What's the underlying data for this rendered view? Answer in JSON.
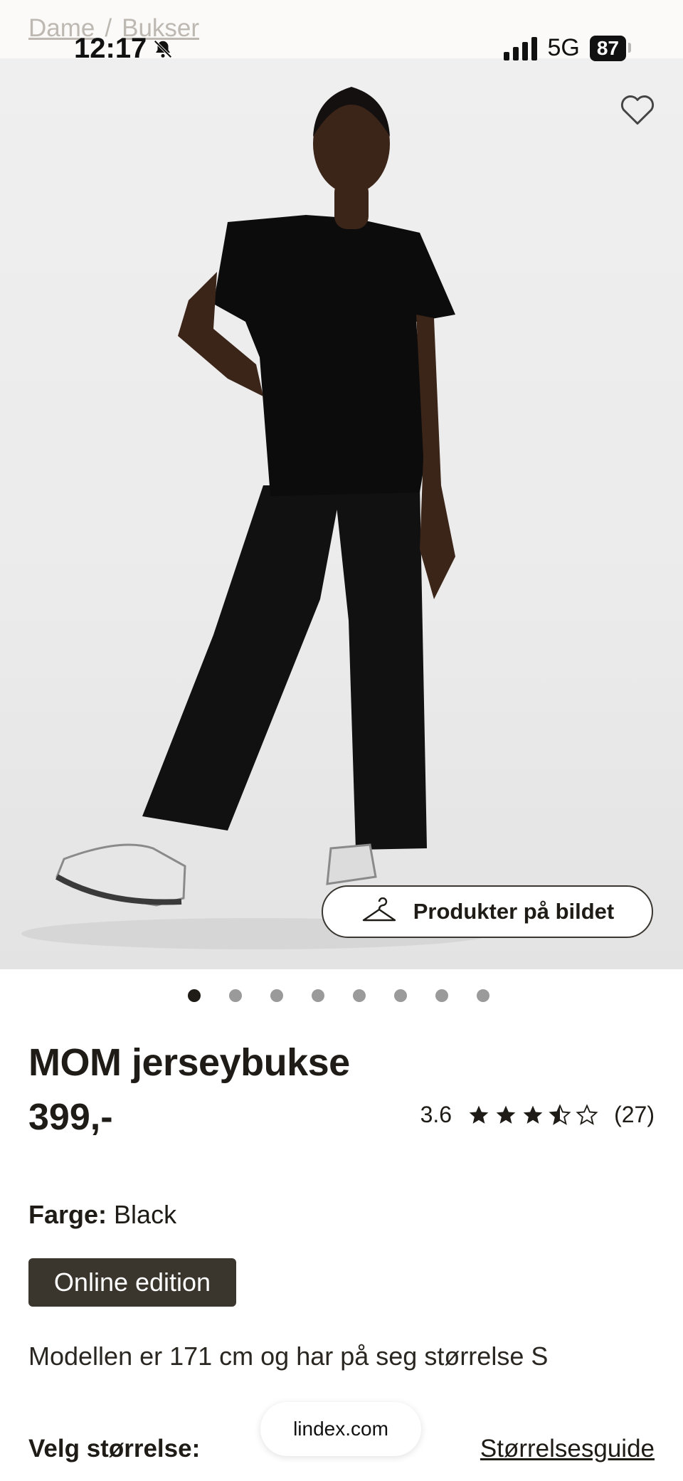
{
  "breadcrumb": {
    "items": [
      "Dame",
      "/",
      "Bukser"
    ]
  },
  "status_bar": {
    "time": "12:17",
    "network": "5G",
    "battery": "87"
  },
  "hero": {
    "products_button_label": "Produkter på bildet",
    "image_count": 8,
    "active_index": 0
  },
  "product": {
    "name": "MOM jerseybukse",
    "price": "399,-",
    "rating_value": "3.6",
    "rating_stars": 3.5,
    "review_count": "(27)",
    "color_label": "Farge:",
    "color_value": "Black",
    "badge": "Online edition",
    "model_info": "Modellen er 171 cm og har på seg størrelse S"
  },
  "size": {
    "label": "Velg størrelse:",
    "guide_link": "Størrelsesguide"
  },
  "browser": {
    "url": "lindex.com"
  },
  "colors": {
    "badge_bg": "#3a352d",
    "text": "#1f1c17"
  },
  "icons": {
    "favorite": "heart-outline-icon",
    "hanger": "hanger-icon",
    "silent": "bell-slash-icon"
  }
}
